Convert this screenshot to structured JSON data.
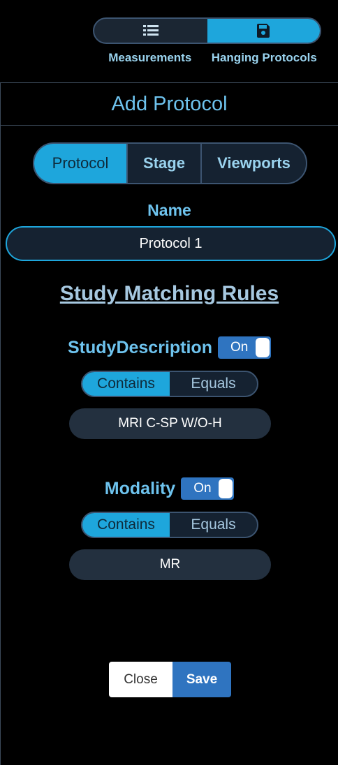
{
  "top_toggle": {
    "items": [
      {
        "label": "Measurements",
        "icon": "list-icon",
        "active": false
      },
      {
        "label": "Hanging Protocols",
        "icon": "save-icon",
        "active": true
      }
    ]
  },
  "panel": {
    "title": "Add Protocol",
    "tabs": [
      {
        "label": "Protocol",
        "active": true
      },
      {
        "label": "Stage",
        "active": false
      },
      {
        "label": "Viewports",
        "active": false
      }
    ],
    "name_label": "Name",
    "name_value": "Protocol 1",
    "rules_title": "Study Matching Rules",
    "rules": [
      {
        "name": "StudyDescription",
        "toggle": "On",
        "mode_options": [
          "Contains",
          "Equals"
        ],
        "selected_mode": "Contains",
        "value": "MRI C-SP W/O-H"
      },
      {
        "name": "Modality",
        "toggle": "On",
        "mode_options": [
          "Contains",
          "Equals"
        ],
        "selected_mode": "Contains",
        "value": "MR"
      }
    ],
    "close_label": "Close",
    "save_label": "Save"
  },
  "colors": {
    "accent": "#1ea6dc",
    "title": "#6ec3ee",
    "save": "#2f74c0"
  }
}
